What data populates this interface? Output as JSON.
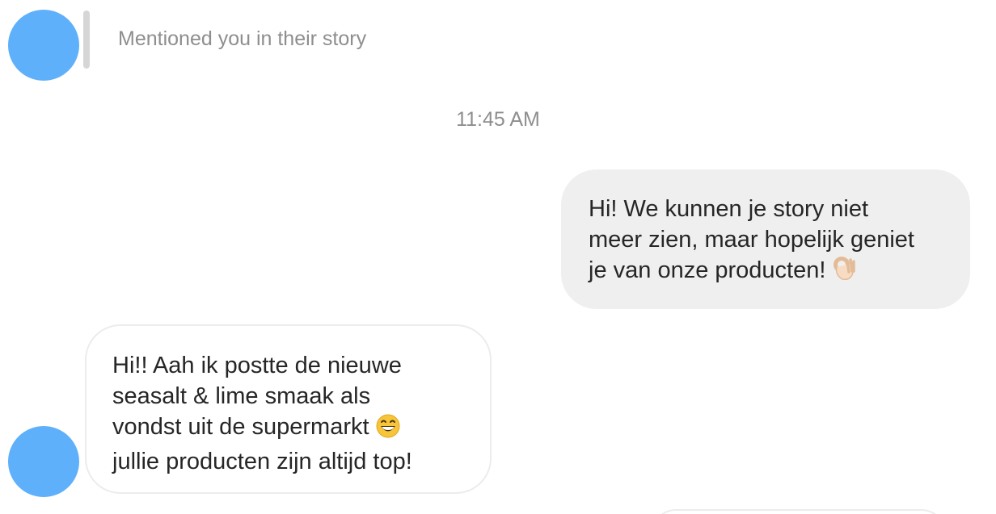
{
  "colors": {
    "avatar": "#5fb0fa",
    "outgoing_bubble": "#efefef",
    "incoming_bubble_border": "#ececec",
    "meta_text": "#8e8e8e",
    "message_text": "#262626"
  },
  "story_mention": {
    "text": "Mentioned you in their story"
  },
  "timestamp": "11:45 AM",
  "messages": [
    {
      "direction": "outgoing",
      "lines": [
        "Hi! We kunnen je story niet",
        "meer zien, maar hopelijk geniet",
        "je van onze producten!"
      ],
      "emoji": "ok-hand-emoji"
    },
    {
      "direction": "incoming",
      "lines": [
        "Hi!! Aah ik postte de nieuwe",
        "seasalt & lime smaak als",
        "vondst uit de supermarkt",
        "jullie producten zijn altijd top!"
      ],
      "emoji": "grinning-face-emoji"
    }
  ]
}
